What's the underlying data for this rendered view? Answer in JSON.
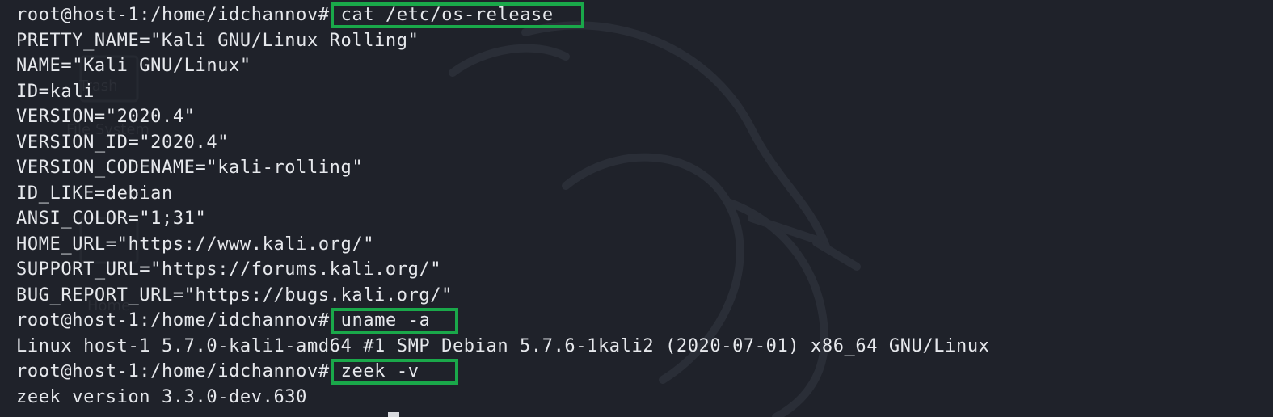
{
  "terminal": {
    "lines": [
      {
        "kind": "prompt",
        "prompt": "root@host-1:/home/idchannov#",
        "command": "cat /etc/os-release"
      },
      {
        "kind": "output",
        "text": "PRETTY_NAME=\"Kali GNU/Linux Rolling\""
      },
      {
        "kind": "output",
        "text": "NAME=\"Kali GNU/Linux\""
      },
      {
        "kind": "output",
        "text": "ID=kali"
      },
      {
        "kind": "output",
        "text": "VERSION=\"2020.4\""
      },
      {
        "kind": "output",
        "text": "VERSION_ID=\"2020.4\""
      },
      {
        "kind": "output",
        "text": "VERSION_CODENAME=\"kali-rolling\""
      },
      {
        "kind": "output",
        "text": "ID_LIKE=debian"
      },
      {
        "kind": "output",
        "text": "ANSI_COLOR=\"1;31\""
      },
      {
        "kind": "output",
        "text": "HOME_URL=\"https://www.kali.org/\""
      },
      {
        "kind": "output",
        "text": "SUPPORT_URL=\"https://forums.kali.org/\""
      },
      {
        "kind": "output",
        "text": "BUG_REPORT_URL=\"https://bugs.kali.org/\""
      },
      {
        "kind": "prompt",
        "prompt": "root@host-1:/home/idchannov#",
        "command": "uname -a"
      },
      {
        "kind": "output",
        "text": "Linux host-1 5.7.0-kali1-amd64 #1 SMP Debian 5.7.6-1kali2 (2020-07-01) x86_64 GNU/Linux"
      },
      {
        "kind": "prompt",
        "prompt": "root@host-1:/home/idchannov#",
        "command": "zeek -v"
      },
      {
        "kind": "output",
        "text": "zeek version 3.3.0-dev.630"
      }
    ],
    "highlight_color": "#1aa84a",
    "background_color": "#1f222a",
    "text_color": "#e6e8ec",
    "wallpaper_icon": "kali-dragon-icon",
    "desktop_labels": {
      "trash": "Trash",
      "fs": "File System",
      "home": "Home"
    }
  }
}
